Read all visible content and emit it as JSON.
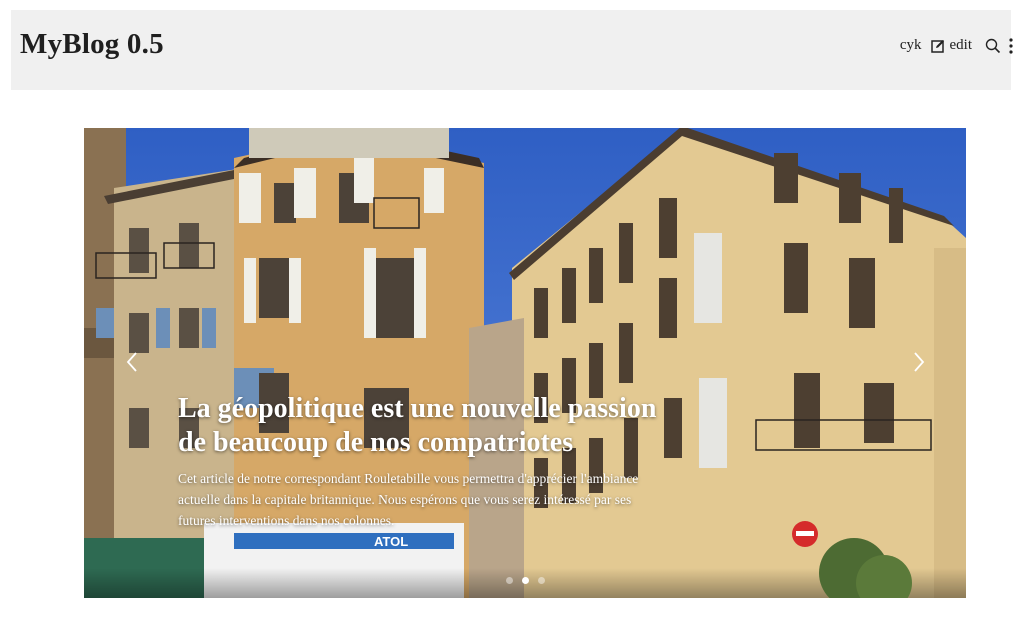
{
  "header": {
    "brand": "MyBlog 0.5",
    "user": "cyk",
    "edit_label": "edit",
    "icons": [
      "edit-icon",
      "search-icon",
      "more-vertical-icon"
    ]
  },
  "carousel": {
    "slide_count": 3,
    "active_index": 1,
    "slide": {
      "title": "La géopolitique est une nouvelle passion de beaucoup de nos compatriotes",
      "text": "Cet article de notre correspondant Rouletabille vous permettra d'apprécier l'ambiance actuelle dans la capitale britannique. Nous espérons que vous serez intéressé par ses futures interventions dans nos colonnes."
    },
    "photo_signs": {
      "optician": "ATOL"
    },
    "controls": [
      "chevron-left-icon",
      "chevron-right-icon"
    ]
  },
  "colors": {
    "header_bg": "#f0f0f0",
    "sky": "#3d6fd1",
    "facade": "#e7cf9a",
    "caption_text": "#ffffff"
  }
}
